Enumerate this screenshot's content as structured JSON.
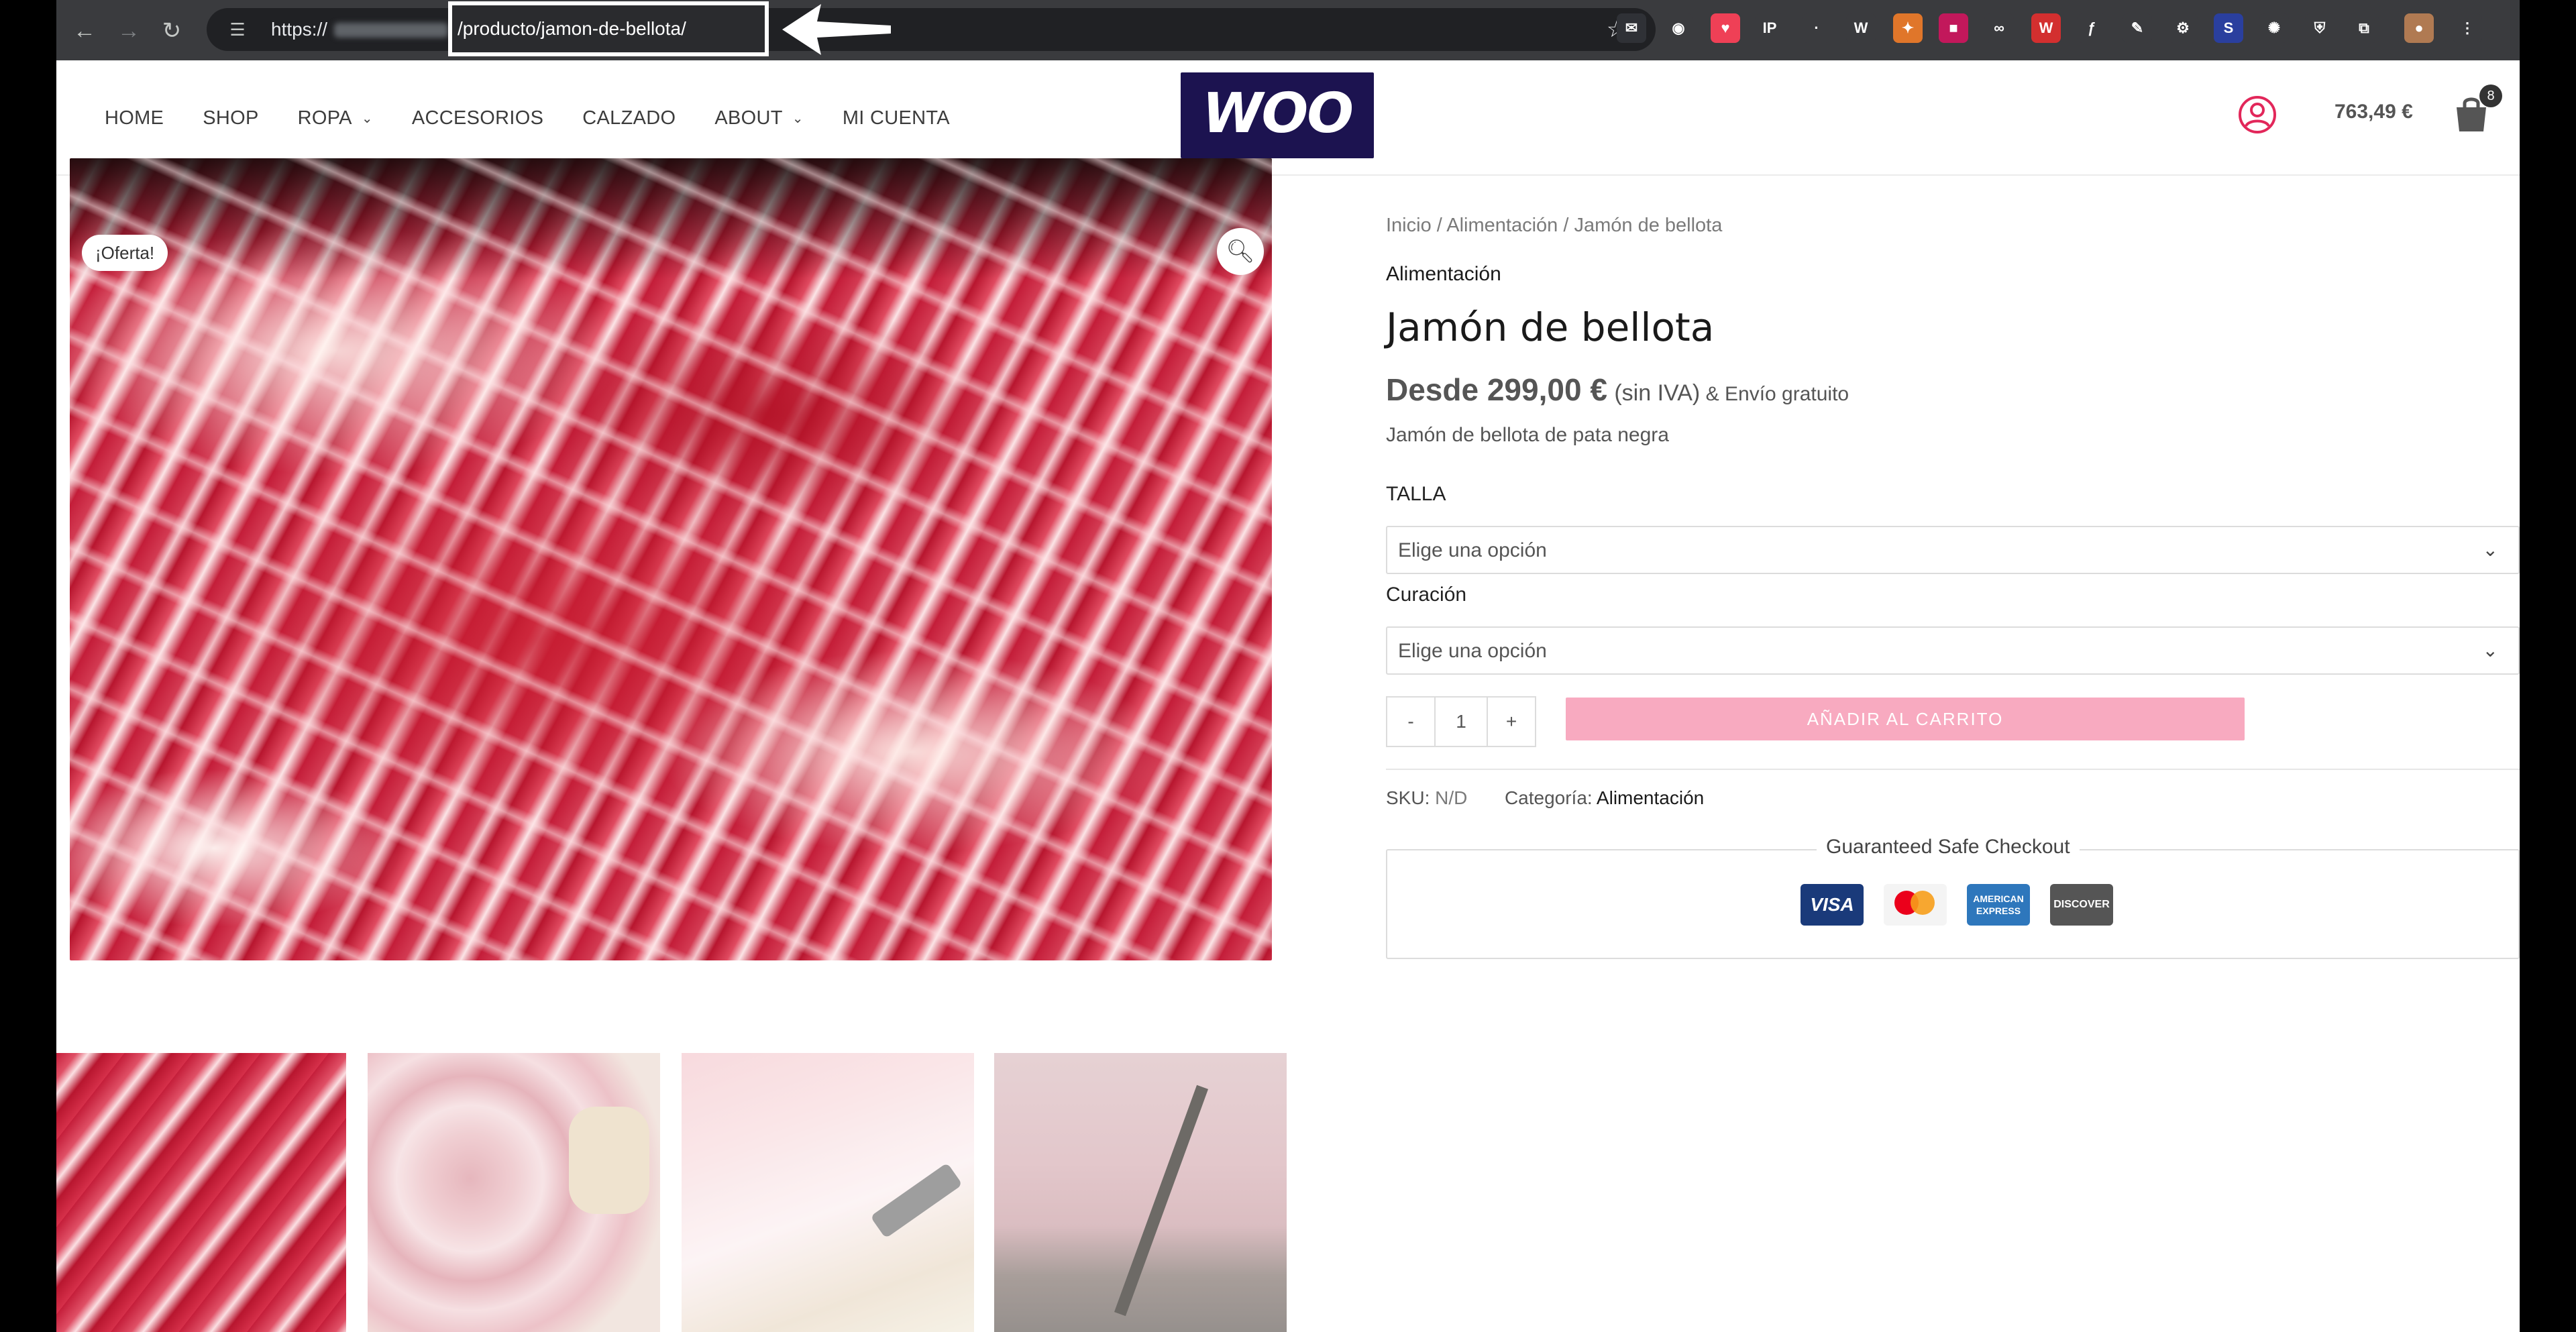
{
  "browser": {
    "url_scheme": "https://",
    "url_path": "/producto/jamon-de-bellota/",
    "back_icon": "arrow-left-icon",
    "forward_icon": "arrow-right-icon",
    "reload_icon": "reload-icon",
    "star_icon": "star-icon",
    "extensions": [
      {
        "name": "mail-extension-icon",
        "glyph": "✉",
        "color": "#2f3136"
      },
      {
        "name": "color-wheel-extension-icon",
        "glyph": "◉",
        "color": "#3a3b3e"
      },
      {
        "name": "pocket-extension-icon",
        "glyph": "♥",
        "color": "#ef4056"
      },
      {
        "name": "ip-extension-icon",
        "glyph": "IP",
        "color": "#3a3b3e"
      },
      {
        "name": "dim-extension-icon",
        "glyph": "·",
        "color": "#3a3b3e"
      },
      {
        "name": "wordpress-extension-icon",
        "glyph": "W",
        "color": "#3a3b3e"
      },
      {
        "name": "fox-extension-icon",
        "glyph": "✦",
        "color": "#e0762a"
      },
      {
        "name": "badge-extension-icon",
        "glyph": "■",
        "color": "#c2185b"
      },
      {
        "name": "link-extension-icon",
        "glyph": "∞",
        "color": "#3a3b3e"
      },
      {
        "name": "wordpress-red-extension-icon",
        "glyph": "W",
        "color": "#d32f2f"
      },
      {
        "name": "function-extension-icon",
        "glyph": "ƒ",
        "color": "#3a3b3e"
      },
      {
        "name": "eyedropper-extension-icon",
        "glyph": "✎",
        "color": "#3a3b3e"
      },
      {
        "name": "gear-extension-icon",
        "glyph": "⚙",
        "color": "#3a3b3e"
      },
      {
        "name": "s-extension-icon",
        "glyph": "S",
        "color": "#2a3f9e"
      },
      {
        "name": "sparkle-extension-icon",
        "glyph": "✺",
        "color": "#3a3b3e"
      },
      {
        "name": "shield-extension-icon",
        "glyph": "⛨",
        "color": "#3a3b3e"
      },
      {
        "name": "puzzle-extension-icon",
        "glyph": "⧉",
        "color": "#3a3b3e"
      },
      {
        "name": "profile-avatar-icon",
        "glyph": "●",
        "color": "#b07a52"
      },
      {
        "name": "kebab-menu-icon",
        "glyph": "⋮",
        "color": "#3a3b3e"
      }
    ]
  },
  "header": {
    "logo_text": "WOO",
    "menu": [
      {
        "label": "HOME",
        "has_dropdown": false
      },
      {
        "label": "SHOP",
        "has_dropdown": false
      },
      {
        "label": "ROPA",
        "has_dropdown": true
      },
      {
        "label": "ACCESORIOS",
        "has_dropdown": false
      },
      {
        "label": "CALZADO",
        "has_dropdown": false
      },
      {
        "label": "ABOUT",
        "has_dropdown": true
      },
      {
        "label": "MI CUENTA",
        "has_dropdown": false
      }
    ],
    "cart_total": "763,49 €",
    "cart_count": "8",
    "accent_color": "#e2275a"
  },
  "gallery": {
    "sale_badge": "¡Oferta!",
    "zoom_icon": "magnifier-icon",
    "thumbnail_count": 4
  },
  "product": {
    "breadcrumb": "Inicio / Alimentación / Jamón de bellota",
    "category": "Alimentación",
    "title": "Jamón de bellota",
    "price": "Desde 299,00 €",
    "tax_note": "(sin IVA)",
    "shipping_note": "& Envío gratuito",
    "short_description": "Jamón de bellota de pata negra",
    "attributes": [
      {
        "label": "TALLA",
        "placeholder": "Elige una opción"
      },
      {
        "label": "Curación",
        "placeholder": "Elige una opción"
      }
    ],
    "quantity": {
      "minus": "-",
      "value": "1",
      "plus": "+"
    },
    "add_to_cart": "AÑADIR AL CARRITO",
    "add_to_cart_color": "#f8aac0",
    "sku_label": "SKU:",
    "sku_value": "N/D",
    "category_label": "Categoría:",
    "category_value": "Alimentación"
  },
  "checkout": {
    "title": "Guaranteed Safe Checkout",
    "cards": {
      "visa": "VISA",
      "mastercard": "mastercard",
      "amex": "AMERICAN EXPRESS",
      "discover": "DISCOVER"
    }
  }
}
